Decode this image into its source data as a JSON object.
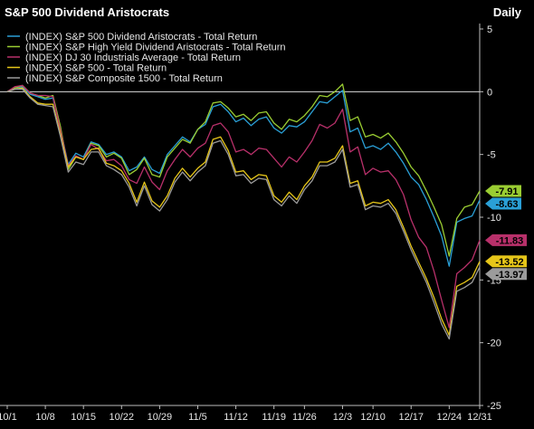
{
  "header": {
    "title": "S&P 500 Dividend Aristocrats",
    "period": "Daily"
  },
  "chart_data": {
    "type": "line",
    "title": "S&P 500 Dividend Aristocrats",
    "xlabel": "",
    "ylabel": "",
    "ylim": [
      -25,
      5
    ],
    "yticks": [
      "5",
      "0",
      "-5",
      "-10",
      "-15",
      "-20",
      "-25"
    ],
    "yticks_values": [
      5,
      0,
      -5,
      -10,
      -15,
      -20,
      -25
    ],
    "grid": false,
    "zero_line": true,
    "legend_position": "top-left",
    "x_ticks": [
      "10/1",
      "10/8",
      "10/15",
      "10/22",
      "10/29",
      "11/5",
      "11/12",
      "11/19",
      "11/26",
      "12/3",
      "12/10",
      "12/17",
      "12/24",
      "12/31"
    ],
    "x": [
      "10/1",
      "10/2",
      "10/3",
      "10/4",
      "10/5",
      "10/8",
      "10/9",
      "10/10",
      "10/11",
      "10/12",
      "10/15",
      "10/16",
      "10/17",
      "10/18",
      "10/19",
      "10/22",
      "10/23",
      "10/24",
      "10/25",
      "10/26",
      "10/29",
      "10/30",
      "10/31",
      "11/1",
      "11/2",
      "11/5",
      "11/6",
      "11/7",
      "11/8",
      "11/9",
      "11/12",
      "11/13",
      "11/14",
      "11/15",
      "11/16",
      "11/19",
      "11/20",
      "11/21",
      "11/23",
      "11/26",
      "11/27",
      "11/28",
      "11/29",
      "11/30",
      "12/3",
      "12/4",
      "12/6",
      "12/7",
      "12/10",
      "12/11",
      "12/12",
      "12/13",
      "12/14",
      "12/17",
      "12/18",
      "12/19",
      "12/20",
      "12/21",
      "12/24",
      "12/26",
      "12/27",
      "12/28",
      "12/31"
    ],
    "series": [
      {
        "name": "(INDEX) S&P 500 Dividend Aristocrats - Total Return",
        "color": "#2a9fd6",
        "end_label": "-8.63",
        "values": [
          0,
          0.3,
          0.4,
          -0.2,
          -0.4,
          -0.6,
          -0.5,
          -3.0,
          -5.8,
          -4.9,
          -5.2,
          -4.0,
          -4.2,
          -5.0,
          -4.8,
          -5.2,
          -6.3,
          -6.0,
          -5.2,
          -6.2,
          -6.5,
          -5.0,
          -4.3,
          -3.6,
          -4.0,
          -3.0,
          -2.6,
          -1.2,
          -1.0,
          -1.6,
          -2.4,
          -2.1,
          -2.7,
          -2.2,
          -2.0,
          -2.9,
          -3.3,
          -2.7,
          -2.8,
          -2.4,
          -1.6,
          -0.8,
          -0.9,
          -0.4,
          0.1,
          -3.2,
          -2.9,
          -4.5,
          -4.3,
          -4.6,
          -4.1,
          -4.8,
          -5.7,
          -6.8,
          -7.4,
          -8.6,
          -10.0,
          -11.5,
          -13.9,
          -10.4,
          -10.1,
          -9.9,
          -8.63
        ]
      },
      {
        "name": "(INDEX) S&P High Yield Dividend Aristocrats - Total Return",
        "color": "#9acd32",
        "end_label": "-7.91",
        "values": [
          0,
          0.3,
          0.5,
          -0.1,
          -0.3,
          -0.5,
          -0.3,
          -2.8,
          -6.2,
          -5.2,
          -5.4,
          -4.1,
          -4.3,
          -5.2,
          -4.9,
          -5.3,
          -6.6,
          -6.2,
          -5.3,
          -6.6,
          -6.8,
          -5.2,
          -4.5,
          -3.8,
          -4.1,
          -3.0,
          -2.4,
          -0.9,
          -0.8,
          -1.3,
          -2.0,
          -1.8,
          -2.3,
          -1.7,
          -1.6,
          -2.5,
          -3.0,
          -2.2,
          -2.4,
          -1.9,
          -1.2,
          -0.3,
          -0.4,
          0.0,
          0.6,
          -2.3,
          -2.0,
          -3.6,
          -3.4,
          -3.7,
          -3.3,
          -4.0,
          -4.9,
          -6.0,
          -6.7,
          -7.9,
          -9.2,
          -10.6,
          -13.1,
          -10.1,
          -9.2,
          -9.0,
          -7.91
        ]
      },
      {
        "name": "(INDEX) DJ 30 Industrials Average - Total Return",
        "color": "#b8306a",
        "end_label": "-11.83",
        "values": [
          0,
          0.4,
          0.5,
          -0.1,
          -0.3,
          -0.3,
          -0.4,
          -3.1,
          -5.9,
          -5.1,
          -5.4,
          -4.2,
          -4.6,
          -5.5,
          -5.4,
          -5.9,
          -7.0,
          -7.3,
          -6.0,
          -7.2,
          -7.8,
          -6.3,
          -5.4,
          -4.6,
          -5.2,
          -4.5,
          -4.1,
          -2.7,
          -2.5,
          -3.2,
          -4.8,
          -4.6,
          -5.0,
          -4.5,
          -4.6,
          -5.3,
          -6.0,
          -5.2,
          -5.6,
          -4.8,
          -3.9,
          -2.6,
          -2.9,
          -2.5,
          -1.4,
          -4.8,
          -4.4,
          -6.6,
          -6.1,
          -6.4,
          -6.3,
          -7.0,
          -8.2,
          -10.2,
          -11.6,
          -12.4,
          -14.3,
          -16.6,
          -18.8,
          -14.5,
          -14.0,
          -13.4,
          -11.83
        ]
      },
      {
        "name": "(INDEX) S&P 500 - Total Return",
        "color": "#e6c619",
        "end_label": "-13.52",
        "values": [
          0,
          0.2,
          0.3,
          -0.4,
          -0.9,
          -1.0,
          -1.0,
          -3.4,
          -6.0,
          -5.2,
          -5.4,
          -4.6,
          -4.5,
          -5.7,
          -5.9,
          -6.3,
          -7.3,
          -8.8,
          -7.2,
          -8.7,
          -9.2,
          -8.3,
          -6.9,
          -6.1,
          -6.8,
          -6.1,
          -5.6,
          -3.8,
          -3.6,
          -4.7,
          -6.4,
          -6.3,
          -7.0,
          -6.6,
          -6.7,
          -8.3,
          -8.8,
          -8.0,
          -8.6,
          -7.5,
          -6.8,
          -5.6,
          -5.6,
          -5.3,
          -4.3,
          -7.3,
          -7.1,
          -9.1,
          -8.8,
          -8.9,
          -8.6,
          -9.4,
          -10.8,
          -12.3,
          -13.6,
          -14.9,
          -16.4,
          -18.1,
          -19.4,
          -15.5,
          -15.2,
          -14.8,
          -13.52
        ]
      },
      {
        "name": "(INDEX) S&P Composite 1500 - Total Return",
        "color": "#9b9b9b",
        "end_label": "-13.97",
        "values": [
          0,
          0.2,
          0.2,
          -0.5,
          -1.0,
          -1.1,
          -1.2,
          -3.6,
          -6.4,
          -5.6,
          -5.8,
          -4.8,
          -4.8,
          -5.9,
          -6.2,
          -6.6,
          -7.6,
          -9.1,
          -7.5,
          -9.0,
          -9.5,
          -8.6,
          -7.2,
          -6.4,
          -7.1,
          -6.4,
          -5.9,
          -4.1,
          -3.9,
          -5.0,
          -6.7,
          -6.6,
          -7.3,
          -6.9,
          -7.0,
          -8.6,
          -9.1,
          -8.3,
          -8.9,
          -7.8,
          -7.1,
          -5.9,
          -5.9,
          -5.6,
          -4.6,
          -7.6,
          -7.4,
          -9.4,
          -9.1,
          -9.2,
          -8.9,
          -9.7,
          -11.1,
          -12.6,
          -13.9,
          -15.2,
          -16.8,
          -18.5,
          -19.7,
          -15.9,
          -15.6,
          -15.2,
          -13.97
        ]
      }
    ]
  }
}
